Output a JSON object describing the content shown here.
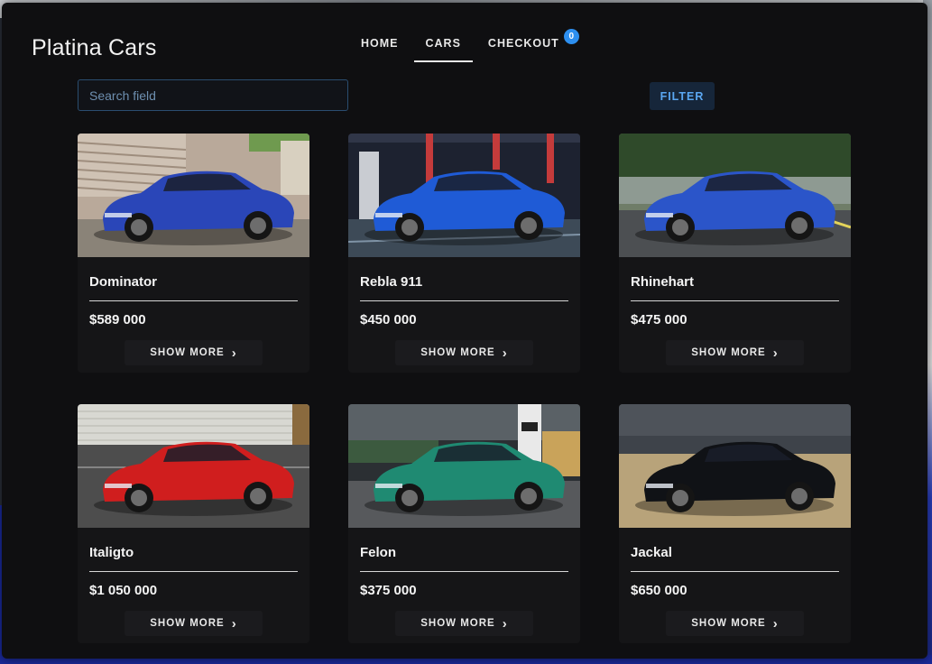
{
  "brand": {
    "title": "Platina Cars"
  },
  "nav": {
    "home": "HOME",
    "cars": "CARS",
    "checkout": "CHECKOUT",
    "checkout_badge": "0",
    "active": "CARS"
  },
  "search": {
    "placeholder": "Search field",
    "value": ""
  },
  "filter": {
    "label": "FILTER"
  },
  "show_more_label": "SHOW MORE",
  "cars": [
    {
      "name": "Dominator",
      "price": "$589 000",
      "color": "#2a46b8",
      "bg": "garage-stairs"
    },
    {
      "name": "Rebla 911",
      "price": "$450 000",
      "color": "#1f5bd6",
      "bg": "showroom"
    },
    {
      "name": "Rhinehart",
      "price": "$475 000",
      "color": "#2b55c9",
      "bg": "hedge-parking"
    },
    {
      "name": "Italigto",
      "price": "$1 050 000",
      "color": "#d01e1e",
      "bg": "brick-wall"
    },
    {
      "name": "Felon",
      "price": "$375 000",
      "color": "#1f8a72",
      "bg": "indoor-garage"
    },
    {
      "name": "Jackal",
      "price": "$650 000",
      "color": "#101216",
      "bg": "sandy-lot"
    }
  ],
  "colors": {
    "accent": "#2d8ff0",
    "window_bg": "#0f0f11",
    "card_bg": "#151517"
  }
}
